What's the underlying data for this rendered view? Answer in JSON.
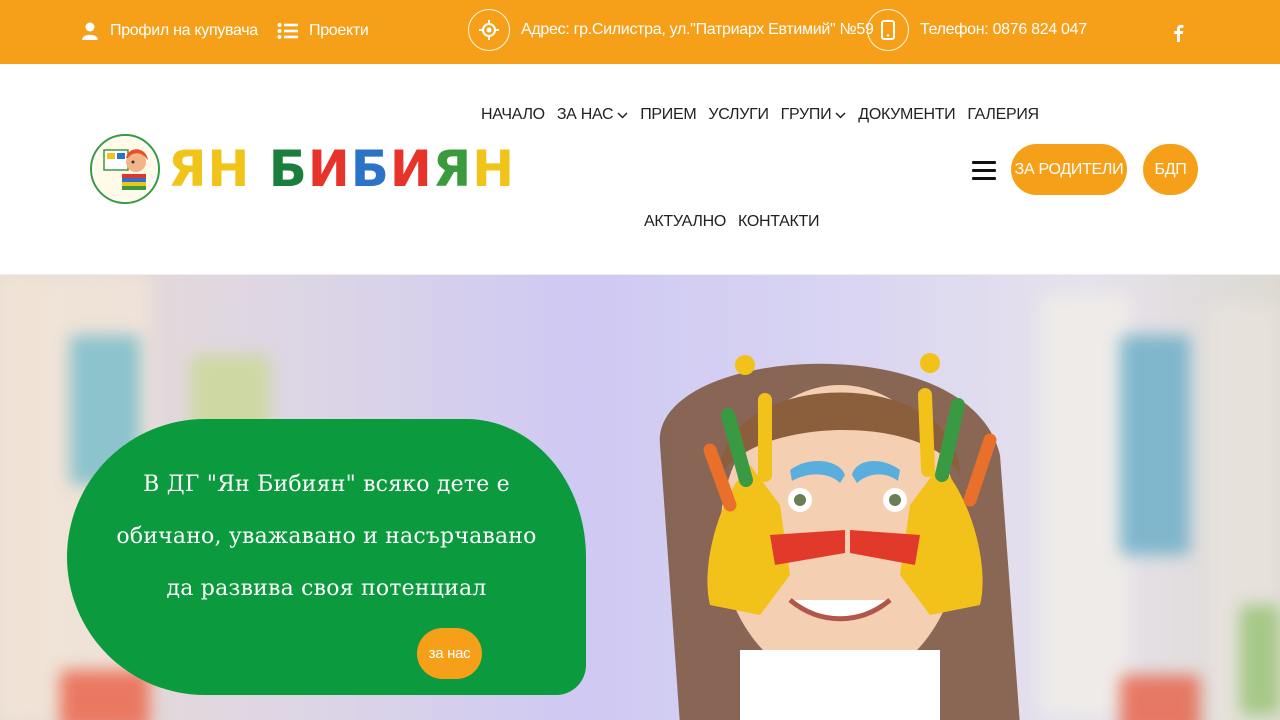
{
  "topbar": {
    "profile_label": "Профил на купувача",
    "projects_label": "Проекти",
    "address_label": "Адрес: гр.Силистра, ул.\"Патриарх Евтимий\" №59",
    "phone_label": "Телефон: 0876 824 047",
    "accent_color": "#f6a01a"
  },
  "logo": {
    "letters": [
      "Я",
      "Н",
      " ",
      "Б",
      "И",
      "Б",
      "И",
      "Я",
      "Н"
    ],
    "letter_colors": [
      "#f0c419",
      "#f0c419",
      "#ffffff",
      "#1a7f3c",
      "#e8332a",
      "#2b72c9",
      "#e8332a",
      "#3c9a3e",
      "#f0c419"
    ]
  },
  "nav": {
    "row1": [
      {
        "label": "НАЧАЛО",
        "dropdown": false
      },
      {
        "label": "ЗА НАС",
        "dropdown": true
      },
      {
        "label": "ПРИЕМ",
        "dropdown": false
      },
      {
        "label": "УСЛУГИ",
        "dropdown": false
      },
      {
        "label": "ГРУПИ",
        "dropdown": true
      },
      {
        "label": "ДОКУМЕНТИ",
        "dropdown": false
      },
      {
        "label": "ГАЛЕРИЯ",
        "dropdown": false
      }
    ],
    "row2": [
      {
        "label": "АКТУАЛНО",
        "dropdown": false
      },
      {
        "label": "КОНТАКТИ",
        "dropdown": false
      }
    ]
  },
  "header_buttons": {
    "parents_label": "ЗА РОДИТЕЛИ",
    "bdp_label": "БДП"
  },
  "hero": {
    "lines": [
      "В ДГ \"Ян Бибиян\" всяко дете е",
      "обичано, уважавано и насърчавано",
      "да развива своя потенциал"
    ],
    "button_label": "за нас",
    "card_color": "#0b9a3e"
  }
}
